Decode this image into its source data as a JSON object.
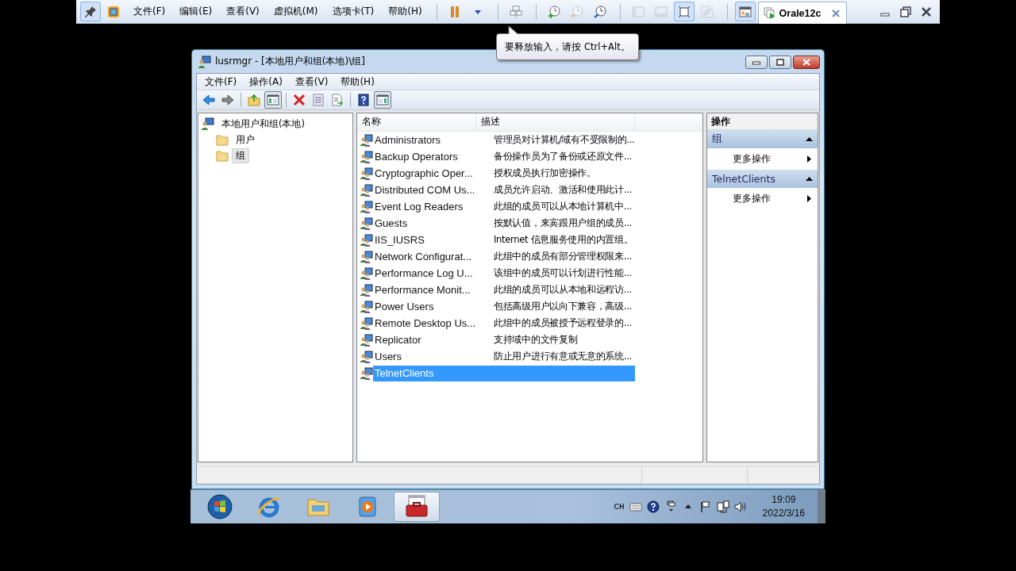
{
  "vm_toolbar": {
    "lead_tools": [
      {
        "kind": "pin",
        "pressed": true,
        "disabled": false
      },
      {
        "kind": "vmlogo",
        "pressed": false,
        "disabled": false
      }
    ],
    "menus": [
      "文件(F)",
      "编辑(E)",
      "查看(V)",
      "虚拟机(M)",
      "选项卡(T)",
      "帮助(H)"
    ],
    "tools": [
      {
        "kind": "sep"
      },
      {
        "kind": "pause",
        "pressed": false,
        "disabled": false
      },
      {
        "kind": "caret",
        "pressed": false,
        "disabled": false
      },
      {
        "kind": "sep"
      },
      {
        "kind": "sendkeys",
        "pressed": false,
        "disabled": false
      },
      {
        "kind": "sep"
      },
      {
        "kind": "snapshot",
        "pressed": false,
        "disabled": false
      },
      {
        "kind": "revert",
        "pressed": false,
        "disabled": true
      },
      {
        "kind": "manager",
        "pressed": false,
        "disabled": false
      },
      {
        "kind": "sep"
      },
      {
        "kind": "consoleleft",
        "pressed": false,
        "disabled": true
      },
      {
        "kind": "consolebottom",
        "pressed": false,
        "disabled": true
      },
      {
        "kind": "fullscreen",
        "pressed": true,
        "disabled": false
      },
      {
        "kind": "unity",
        "pressed": false,
        "disabled": true
      },
      {
        "kind": "sep"
      },
      {
        "kind": "consoleview",
        "pressed": true,
        "disabled": false
      }
    ],
    "tab": {
      "label": "Orale12c",
      "selected": true
    }
  },
  "tooltip": {
    "text": "要释放输入，请按 Ctrl+Alt。"
  },
  "window": {
    "title": "lusrmgr - [本地用户和组(本地)\\组]",
    "menu": [
      "文件(F)",
      "操作(A)",
      "查看(V)",
      "帮助(H)"
    ],
    "tools": [
      {
        "kind": "back",
        "pressed": false
      },
      {
        "kind": "forward",
        "pressed": false
      },
      {
        "kind": "sep"
      },
      {
        "kind": "up",
        "pressed": false
      },
      {
        "kind": "treetoggle",
        "pressed": true
      },
      {
        "kind": "sep"
      },
      {
        "kind": "delete",
        "pressed": false
      },
      {
        "kind": "properties",
        "pressed": false
      },
      {
        "kind": "export",
        "pressed": false
      },
      {
        "kind": "sep"
      },
      {
        "kind": "help",
        "pressed": false
      },
      {
        "kind": "actiontoggle",
        "pressed": true
      }
    ],
    "tree": [
      {
        "label": "本地用户和组(本地)",
        "kind": "computer",
        "selected": false,
        "children": [
          {
            "label": "用户",
            "kind": "folder",
            "selected": false
          },
          {
            "label": "组",
            "kind": "folder",
            "selected": true
          }
        ]
      }
    ],
    "list": {
      "columns": [
        "名称",
        "描述"
      ],
      "rows": [
        {
          "name": "Administrators",
          "description": "管理员对计算机/域有不受限制的...",
          "selected": false
        },
        {
          "name": "Backup Operators",
          "description": "备份操作员为了备份或还原文件...",
          "selected": false
        },
        {
          "name": "Cryptographic Oper...",
          "description": "授权成员执行加密操作。",
          "selected": false
        },
        {
          "name": "Distributed COM Us...",
          "description": "成员允许启动、激活和使用此计...",
          "selected": false
        },
        {
          "name": "Event Log Readers",
          "description": "此组的成员可以从本地计算机中...",
          "selected": false
        },
        {
          "name": "Guests",
          "description": "按默认值，来宾跟用户组的成员...",
          "selected": false
        },
        {
          "name": "IIS_IUSRS",
          "description": "Internet 信息服务使用的内置组。",
          "selected": false
        },
        {
          "name": "Network Configurat...",
          "description": "此组中的成员有部分管理权限来...",
          "selected": false
        },
        {
          "name": "Performance Log U...",
          "description": "该组中的成员可以计划进行性能...",
          "selected": false
        },
        {
          "name": "Performance Monit...",
          "description": "此组的成员可以从本地和远程访...",
          "selected": false
        },
        {
          "name": "Power Users",
          "description": "包括高级用户以向下兼容，高级...",
          "selected": false
        },
        {
          "name": "Remote Desktop Us...",
          "description": "此组中的成员被授予远程登录的...",
          "selected": false
        },
        {
          "name": "Replicator",
          "description": "支持域中的文件复制",
          "selected": false
        },
        {
          "name": "Users",
          "description": "防止用户进行有意或无意的系统...",
          "selected": false
        },
        {
          "name": "TelnetClients",
          "selected": true
        }
      ]
    },
    "actions": {
      "title": "操作",
      "sections": [
        {
          "title": "组",
          "expanded": true,
          "items": [
            "更多操作"
          ]
        },
        {
          "title": "TelnetClients",
          "expanded": true,
          "items": [
            "更多操作"
          ]
        }
      ]
    }
  },
  "taskbar": {
    "apps": [
      {
        "kind": "start",
        "selected": false
      },
      {
        "kind": "ie",
        "selected": false
      },
      {
        "kind": "explorer",
        "selected": false
      },
      {
        "kind": "media",
        "selected": false
      },
      {
        "kind": "toolbox",
        "selected": true
      }
    ],
    "language": "CH",
    "tray": [
      {
        "kind": "keyboard"
      },
      {
        "kind": "help"
      },
      {
        "kind": "pen"
      },
      {
        "kind": "uparrow"
      },
      {
        "kind": "flag"
      },
      {
        "kind": "network"
      },
      {
        "kind": "speaker"
      }
    ],
    "time": "19:09",
    "date": "2022/3/16"
  }
}
